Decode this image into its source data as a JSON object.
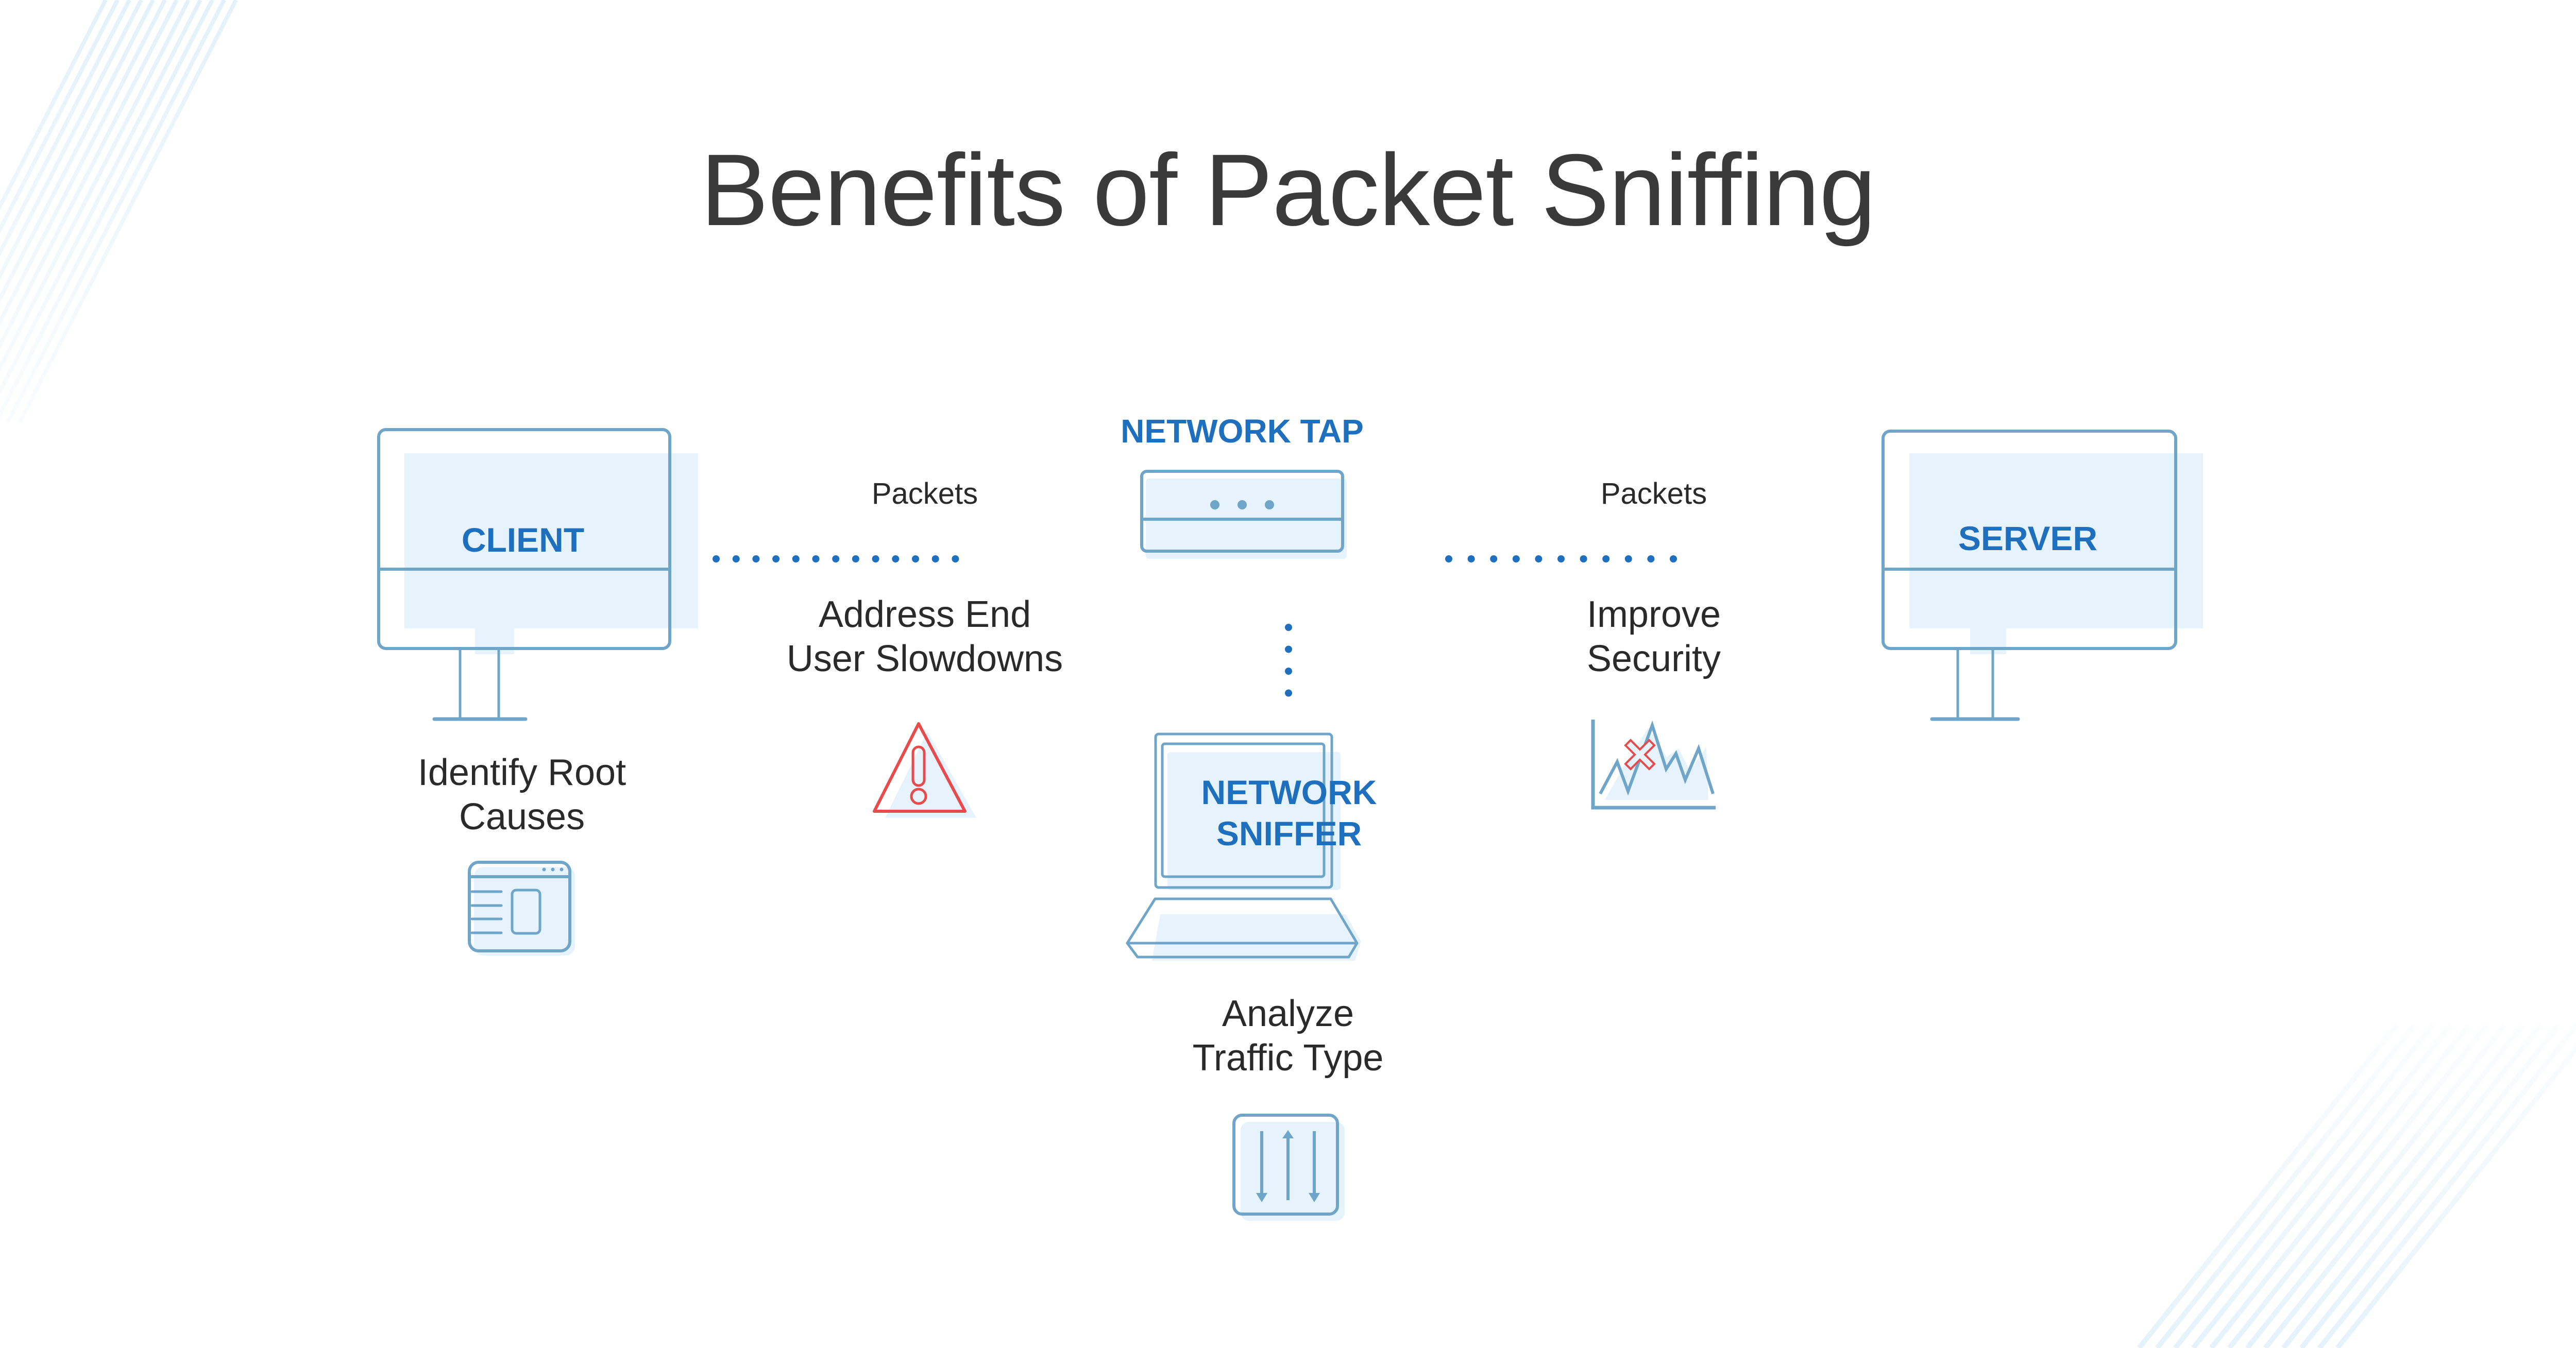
{
  "title": "Benefits of Packet Sniffing",
  "colors": {
    "title_text": "#3a3a3a",
    "label_blue": "#1f6fbf",
    "outline": "#6ea5c8",
    "fill_light": "#e6f3fc",
    "dots": "#1f6fbf",
    "alert_red": "#e84b4b",
    "background_stripes": "#e3f1fa"
  },
  "nodes": {
    "client": {
      "label": "CLIENT",
      "icon": "desktop-monitor-icon"
    },
    "server": {
      "label": "SERVER",
      "icon": "desktop-monitor-icon"
    },
    "network_tap": {
      "label": "NETWORK TAP",
      "icon": "network-tap-device-icon"
    },
    "network_sniffer": {
      "label": "NETWORK\nSNIFFER",
      "icon": "laptop-icon"
    }
  },
  "connections": [
    {
      "from": "client",
      "to": "network_tap",
      "label": "Packets",
      "style": "dotted"
    },
    {
      "from": "network_tap",
      "to": "server",
      "label": "Packets",
      "style": "dotted"
    },
    {
      "from": "network_tap",
      "to": "network_sniffer",
      "label": "",
      "style": "dotted"
    }
  ],
  "benefits": [
    {
      "id": "root-causes",
      "text": "Identify Root\nCauses",
      "icon": "browser-window-icon"
    },
    {
      "id": "slowdowns",
      "text": "Address End\nUser Slowdowns",
      "icon": "warning-triangle-icon"
    },
    {
      "id": "traffic-type",
      "text": "Analyze\nTraffic Type",
      "icon": "up-down-arrows-icon"
    },
    {
      "id": "security",
      "text": "Improve\nSecurity",
      "icon": "chart-anomaly-x-icon"
    }
  ]
}
